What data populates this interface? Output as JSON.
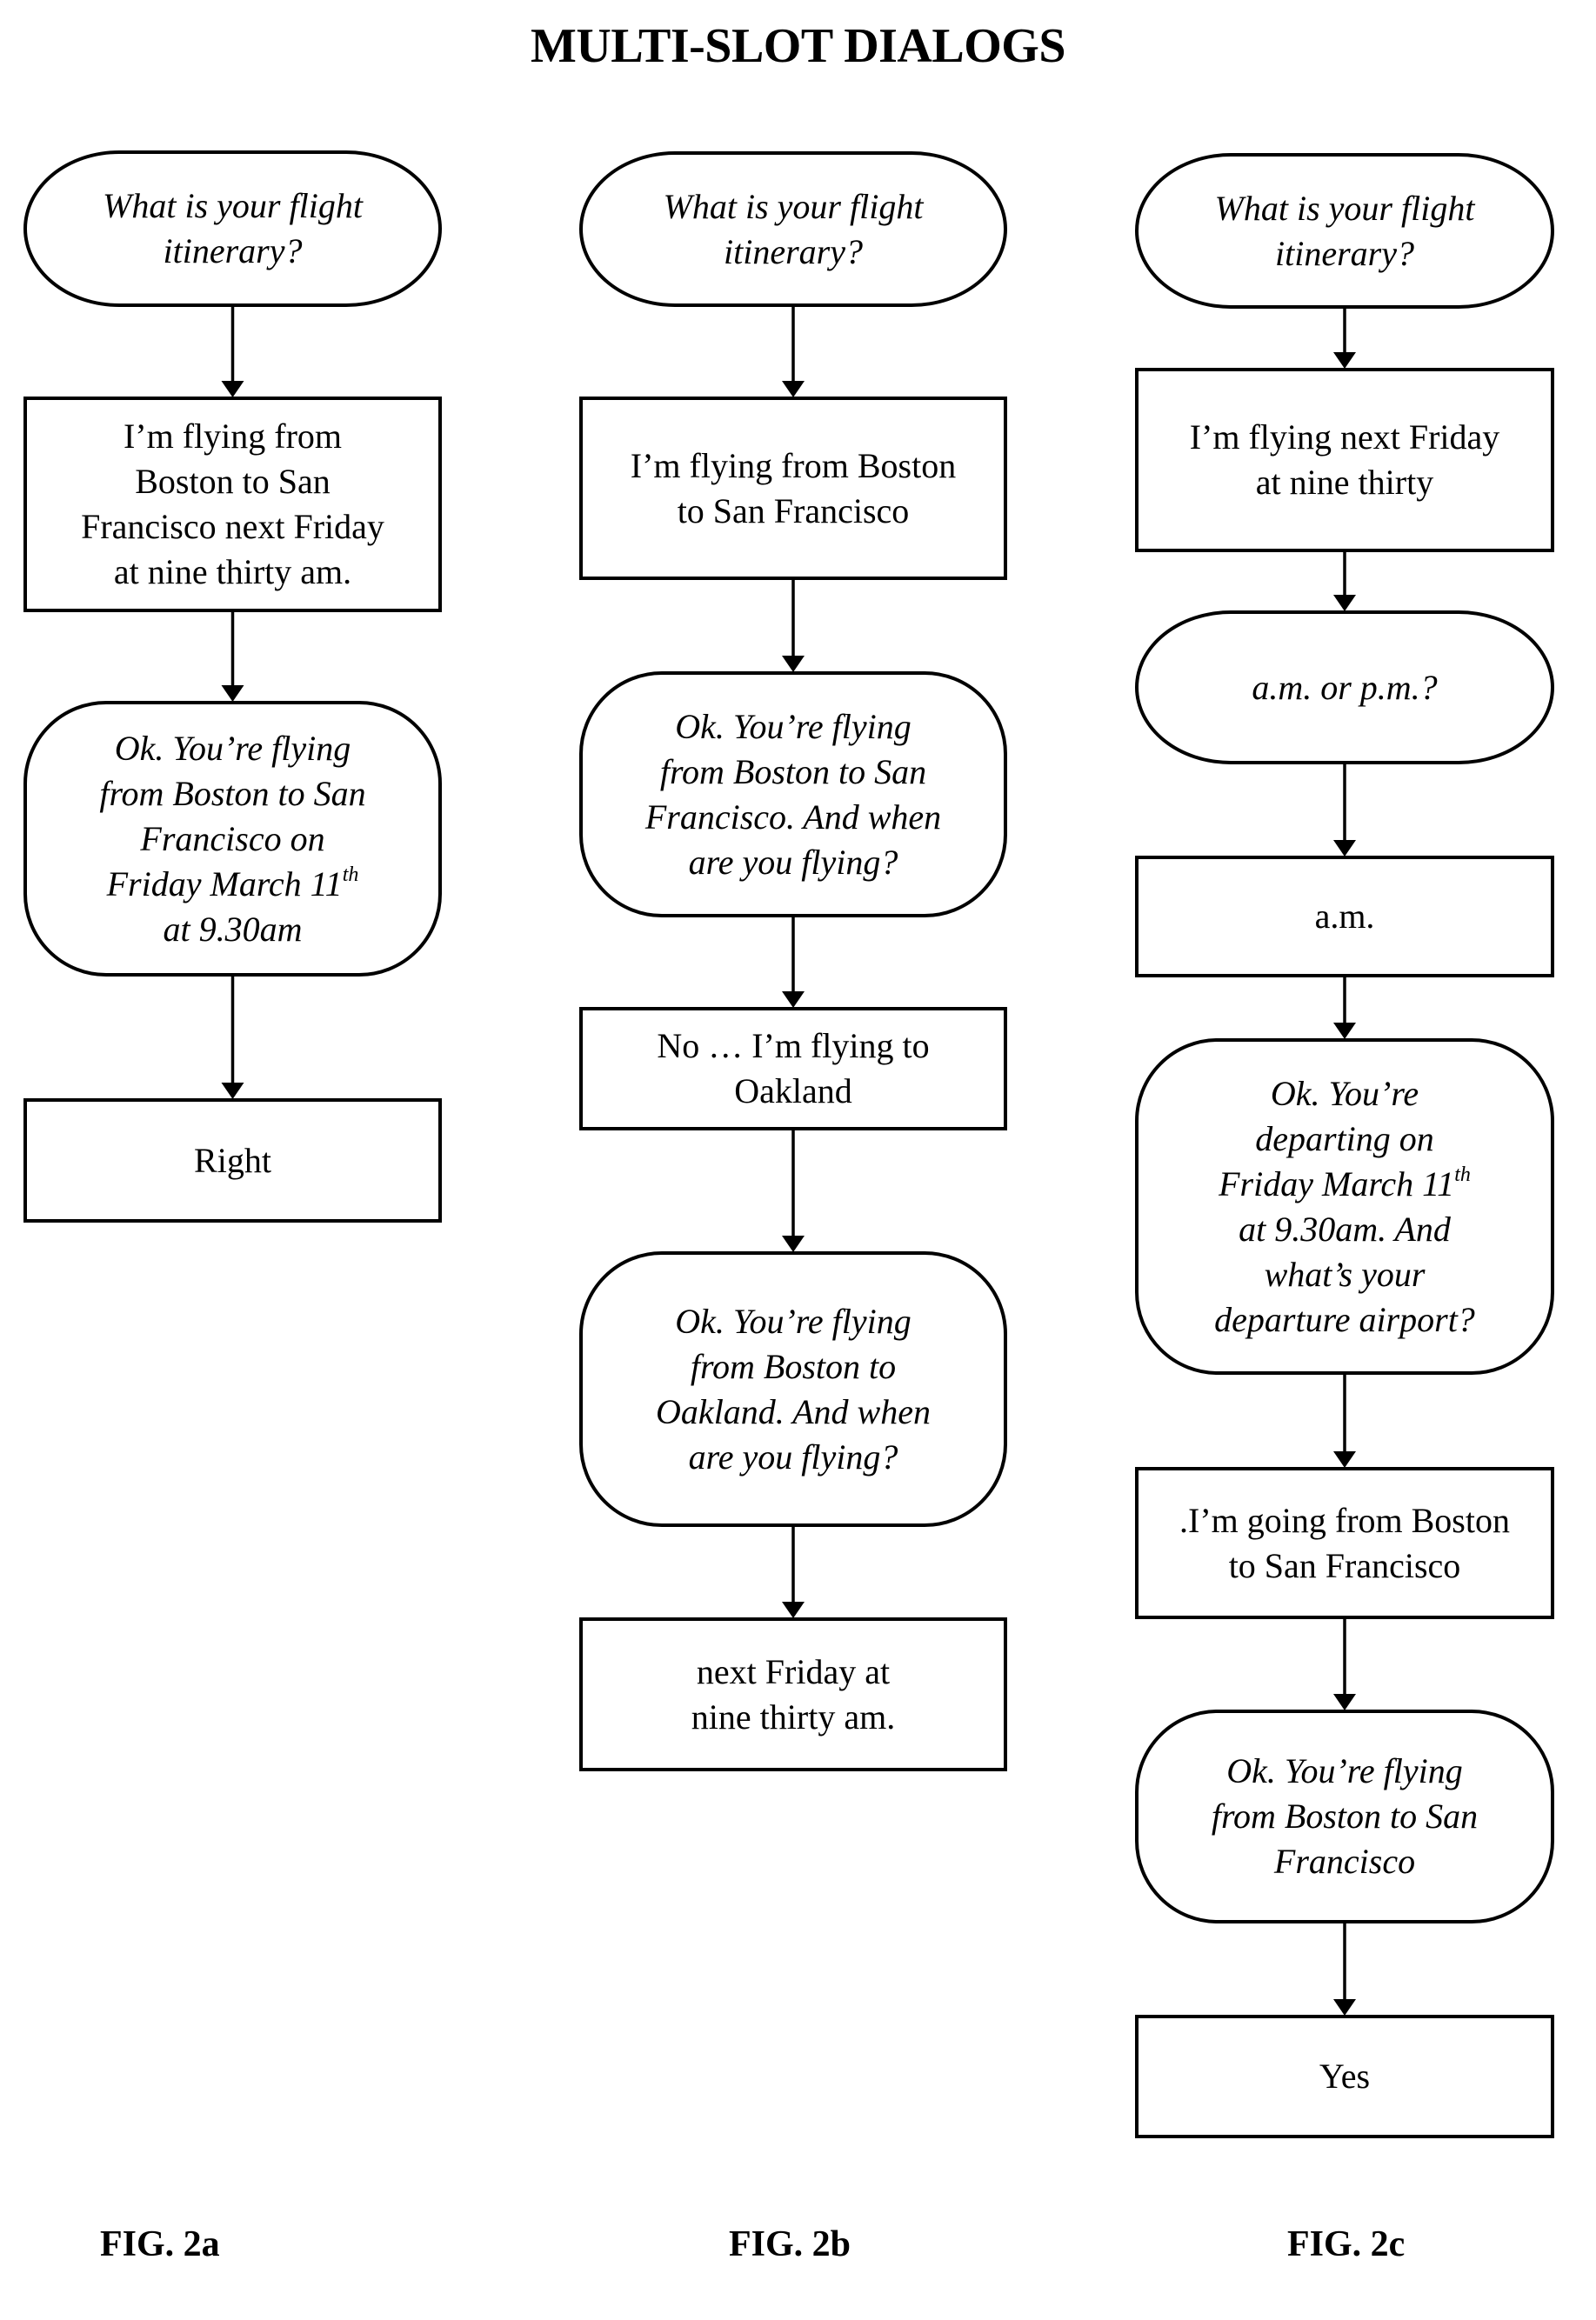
{
  "title": "MULTI-SLOT DIALOGS",
  "columns": [
    {
      "figure_label": "FIG. 2a",
      "nodes": [
        {
          "type": "system",
          "lines": [
            "What is your flight",
            "itinerary?"
          ]
        },
        {
          "type": "user",
          "lines": [
            "I’m flying from",
            "Boston to San",
            "Francisco next Friday",
            "at nine thirty am."
          ]
        },
        {
          "type": "system",
          "lines": [
            "Ok. You’re flying",
            "from Boston to San",
            "Francisco on",
            "Friday March 11",
            "at 9.30am"
          ],
          "superscript": {
            "line": 3,
            "text": "th"
          }
        },
        {
          "type": "user",
          "lines": [
            "Right"
          ]
        }
      ]
    },
    {
      "figure_label": "FIG. 2b",
      "nodes": [
        {
          "type": "system",
          "lines": [
            "What is your flight",
            "itinerary?"
          ]
        },
        {
          "type": "user",
          "lines": [
            "I’m flying from Boston",
            "to San Francisco"
          ]
        },
        {
          "type": "system",
          "lines": [
            "Ok. You’re flying",
            "from Boston to San",
            "Francisco. And when",
            "are you flying?"
          ]
        },
        {
          "type": "user",
          "lines": [
            "No … I’m flying to",
            "Oakland"
          ]
        },
        {
          "type": "system",
          "lines": [
            "Ok. You’re flying",
            "from Boston to",
            "Oakland. And when",
            "are you flying?"
          ]
        },
        {
          "type": "user",
          "lines": [
            "next Friday at",
            "nine thirty am."
          ]
        }
      ]
    },
    {
      "figure_label": "FIG. 2c",
      "nodes": [
        {
          "type": "system",
          "lines": [
            "What is your flight",
            "itinerary?"
          ]
        },
        {
          "type": "user",
          "lines": [
            "I’m flying next Friday",
            "at nine thirty"
          ]
        },
        {
          "type": "system",
          "lines": [
            "a.m. or p.m.?"
          ]
        },
        {
          "type": "user",
          "lines": [
            "a.m."
          ]
        },
        {
          "type": "system",
          "lines": [
            "Ok. You’re",
            "departing on",
            "Friday March 11",
            "at 9.30am. And",
            "what’s your",
            "departure airport?"
          ],
          "superscript": {
            "line": 2,
            "text": "th"
          }
        },
        {
          "type": "user",
          "lines": [
            ".I’m going from Boston",
            "to San Francisco"
          ]
        },
        {
          "type": "system",
          "lines": [
            "Ok. You’re flying",
            "from Boston to San",
            "Francisco"
          ]
        },
        {
          "type": "user",
          "lines": [
            "Yes"
          ]
        }
      ]
    }
  ],
  "legend": {
    "system_prompt_shape": "rounded-terminal (italic text)",
    "user_response_shape": "rectangle (upright text)"
  }
}
